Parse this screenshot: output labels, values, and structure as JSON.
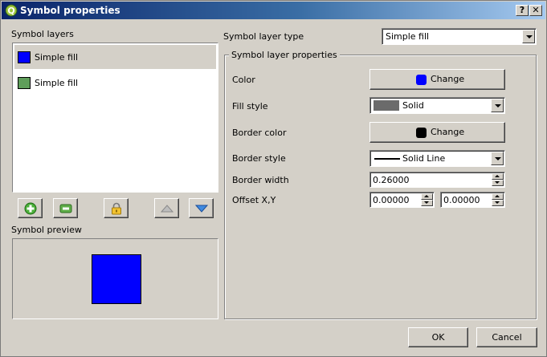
{
  "window": {
    "title": "Symbol properties",
    "help_label": "?",
    "close_label": "✕",
    "app_icon": "qgis-logo-icon"
  },
  "left": {
    "layers_label": "Symbol layers",
    "layers": [
      {
        "label": "Simple fill",
        "color": "#0000ff",
        "selected": true
      },
      {
        "label": "Simple fill",
        "color": "#5f9e5a",
        "selected": false
      }
    ],
    "toolbar": {
      "add_icon": "add-layer-icon",
      "remove_icon": "remove-layer-icon",
      "lock_icon": "lock-icon",
      "up_icon": "move-up-icon",
      "down_icon": "move-down-icon"
    },
    "preview_label": "Symbol preview",
    "preview_color": "#0000ff"
  },
  "right": {
    "layer_type_label": "Symbol layer type",
    "layer_type_value": "Simple fill",
    "props_title": "Symbol layer properties",
    "color_label": "Color",
    "color_button": "Change",
    "color_value": "#0000ff",
    "fill_style_label": "Fill style",
    "fill_style_value": "Solid",
    "fill_style_swatch": "#6b6b6b",
    "border_color_label": "Border color",
    "border_color_button": "Change",
    "border_color_value": "#000000",
    "border_style_label": "Border style",
    "border_style_value": "Solid Line",
    "border_width_label": "Border width",
    "border_width_value": "0.26000",
    "offset_label": "Offset X,Y",
    "offset_x": "0.00000",
    "offset_y": "0.00000"
  },
  "footer": {
    "ok_label": "OK",
    "cancel_label": "Cancel"
  }
}
